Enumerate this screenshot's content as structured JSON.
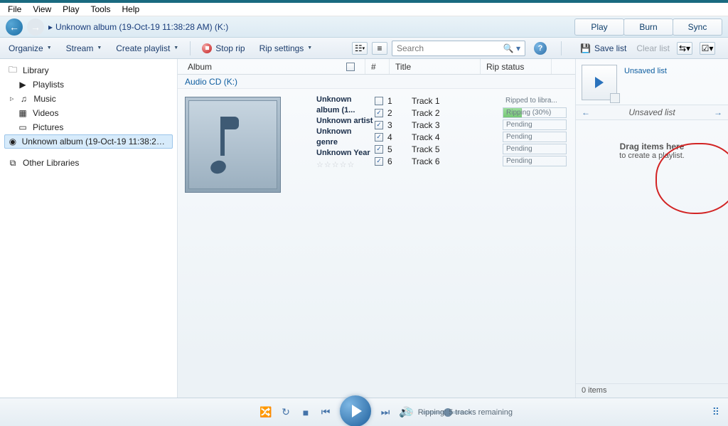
{
  "menubar": [
    "File",
    "View",
    "Play",
    "Tools",
    "Help"
  ],
  "breadcrumb": "Unknown album (19-Oct-19 11:38:28 AM) (K:)",
  "tabs": {
    "play": "Play",
    "burn": "Burn",
    "sync": "Sync"
  },
  "toolbar": {
    "organize": "Organize",
    "stream": "Stream",
    "create_playlist": "Create playlist",
    "stop_rip": "Stop rip",
    "rip_settings": "Rip settings",
    "search_placeholder": "Search",
    "save_list": "Save list",
    "clear_list": "Clear list"
  },
  "sidebar": {
    "library": "Library",
    "playlists": "Playlists",
    "music": "Music",
    "videos": "Videos",
    "pictures": "Pictures",
    "album": "Unknown album (19-Oct-19 11:38:28 AM) (K:)",
    "other_libraries": "Other Libraries"
  },
  "columns": {
    "album": "Album",
    "num": "#",
    "title": "Title",
    "rip_status": "Rip status"
  },
  "subheader": "Audio CD (K:)",
  "album_meta": {
    "title": "Unknown album (1...",
    "artist": "Unknown artist",
    "genre": "Unknown genre",
    "year": "Unknown Year"
  },
  "tracks": [
    {
      "checked": false,
      "num": "1",
      "title": "Track 1",
      "status": "Ripped to libra...",
      "type": "plain"
    },
    {
      "checked": true,
      "num": "2",
      "title": "Track 2",
      "status": "Ripping (30%)",
      "type": "progress"
    },
    {
      "checked": true,
      "num": "3",
      "title": "Track 3",
      "status": "Pending",
      "type": "box"
    },
    {
      "checked": true,
      "num": "4",
      "title": "Track 4",
      "status": "Pending",
      "type": "box"
    },
    {
      "checked": true,
      "num": "5",
      "title": "Track 5",
      "status": "Pending",
      "type": "box"
    },
    {
      "checked": true,
      "num": "6",
      "title": "Track 6",
      "status": "Pending",
      "type": "box"
    }
  ],
  "right_panel": {
    "unsaved_list": "Unsaved list",
    "header": "Unsaved list",
    "drag": "Drag items here",
    "sub": "to create a playlist.",
    "footer": "0 items"
  },
  "player_status": "Ripping: 5 tracks remaining"
}
